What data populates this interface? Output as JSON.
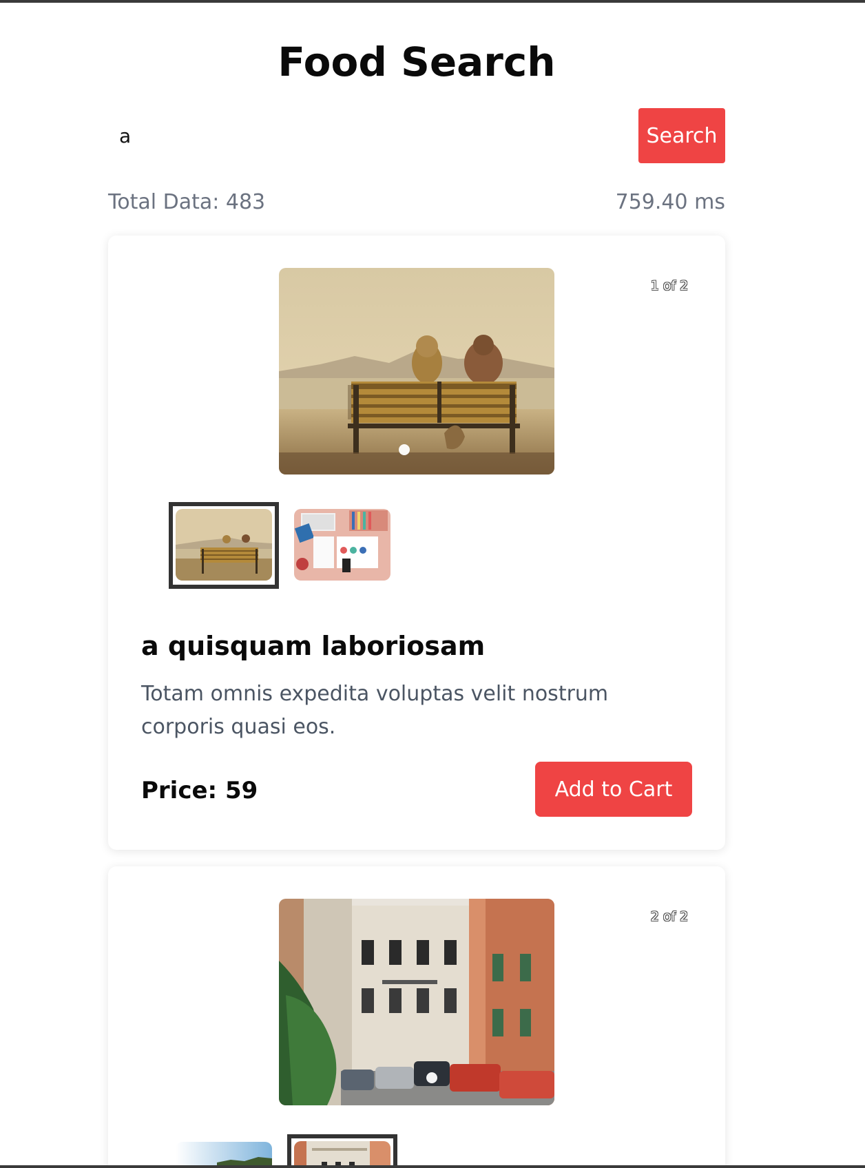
{
  "app": {
    "title": "Food Search"
  },
  "search": {
    "value": "a",
    "placeholder": "",
    "button_label": "Search"
  },
  "stats": {
    "total_label": "Total Data: 483",
    "time_label": "759.40 ms"
  },
  "results": [
    {
      "counter": "1 of 2",
      "title": "a quisquam laboriosam",
      "description": "Totam omnis expedita voluptas velit nostrum corporis quasi eos.",
      "price_label": "Price: 59",
      "cart_label": "Add to Cart",
      "images": [
        "bench-by-sea-photo",
        "desk-flatlay-photo"
      ],
      "selected_image": 1
    },
    {
      "counter": "2 of 2",
      "images": [
        "sky-landscape-photo",
        "old-town-street-photo"
      ],
      "selected_image": 2
    }
  ],
  "colors": {
    "accent": "#ef4444",
    "muted_text": "#6b7280",
    "body_text": "#4b5563"
  }
}
